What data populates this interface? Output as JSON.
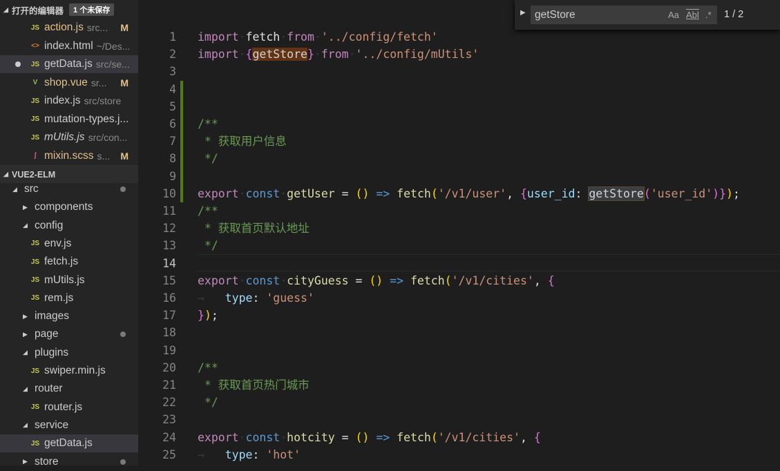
{
  "sidebar": {
    "open_editors": {
      "title": "打开的编辑器",
      "badge": "1 个未保存"
    },
    "open_files": [
      {
        "icon": "js-icon",
        "name": "action.js",
        "desc": "src...",
        "status": "M"
      },
      {
        "icon": "html-icon",
        "name": "index.html",
        "desc": "~/Des..."
      },
      {
        "icon": "js-icon",
        "name": "getData.js",
        "desc": "src/se...",
        "unsaved": true
      },
      {
        "icon": "vue-icon",
        "name": "shop.vue",
        "desc": "sr...",
        "status": "M"
      },
      {
        "icon": "js-icon",
        "name": "index.js",
        "desc": "src/store"
      },
      {
        "icon": "js-icon",
        "name": "mutation-types.j...",
        "desc": ""
      },
      {
        "icon": "js-icon",
        "name": "mUtils.js",
        "desc": "src/con..."
      },
      {
        "icon": "scss-icon",
        "name": "mixin.scss",
        "desc": "s...",
        "status": "M"
      }
    ],
    "project": {
      "title": "VUE2-ELM"
    },
    "tree": [
      {
        "name": "src",
        "type": "folder-open",
        "depth": 1,
        "dot": true
      },
      {
        "name": "components",
        "type": "folder",
        "depth": 2
      },
      {
        "name": "config",
        "type": "folder-open",
        "depth": 2
      },
      {
        "name": "env.js",
        "type": "js",
        "depth": 3
      },
      {
        "name": "fetch.js",
        "type": "js",
        "depth": 3
      },
      {
        "name": "mUtils.js",
        "type": "js",
        "depth": 3
      },
      {
        "name": "rem.js",
        "type": "js",
        "depth": 3
      },
      {
        "name": "images",
        "type": "folder",
        "depth": 2
      },
      {
        "name": "page",
        "type": "folder",
        "depth": 2,
        "dot": true
      },
      {
        "name": "plugins",
        "type": "folder-open",
        "depth": 2
      },
      {
        "name": "swiper.min.js",
        "type": "js",
        "depth": 3
      },
      {
        "name": "router",
        "type": "folder-open",
        "depth": 2
      },
      {
        "name": "router.js",
        "type": "js",
        "depth": 3
      },
      {
        "name": "service",
        "type": "folder-open",
        "depth": 2
      },
      {
        "name": "getData.js",
        "type": "js",
        "depth": 3,
        "selected": true
      },
      {
        "name": "store",
        "type": "folder",
        "depth": 2,
        "dot": true
      }
    ]
  },
  "find": {
    "query": "getStore",
    "match_case": "Aa",
    "whole_word": "Abl",
    "regex": ".*",
    "count": "1 / 2"
  },
  "editor": {
    "current_line": 14,
    "lines": [
      [
        [
          "kw",
          "import"
        ],
        [
          "ws",
          "·"
        ],
        [
          "id",
          "fetch"
        ],
        [
          "ws",
          "·"
        ],
        [
          "kw",
          "from"
        ],
        [
          "ws",
          "·"
        ],
        [
          "s",
          "'../config/fetch'"
        ]
      ],
      [
        [
          "kw",
          "import"
        ],
        [
          "ws",
          "·"
        ],
        [
          "b",
          "{"
        ],
        [
          "hl",
          "getStore"
        ],
        [
          "b",
          "}"
        ],
        [
          "ws",
          "·"
        ],
        [
          "kw",
          "from"
        ],
        [
          "ws",
          "·"
        ],
        [
          "s",
          "'../config/mUtils'"
        ]
      ],
      [],
      [],
      [],
      [
        [
          "c",
          "/**"
        ]
      ],
      [
        [
          "c",
          " * 获取用户信息"
        ]
      ],
      [
        [
          "c",
          " */"
        ]
      ],
      [],
      [
        [
          "kw",
          "export"
        ],
        [
          "ws",
          "·"
        ],
        [
          "st",
          "const"
        ],
        [
          "ws",
          "·"
        ],
        [
          "fn",
          "getUser"
        ],
        [
          "id",
          " = "
        ],
        [
          "p",
          "()"
        ],
        [
          "st",
          " => "
        ],
        [
          "fn",
          "fetch"
        ],
        [
          "p",
          "("
        ],
        [
          "s",
          "'/v1/user'"
        ],
        [
          "id",
          ", "
        ],
        [
          "b",
          "{"
        ],
        [
          "pr",
          "user_id"
        ],
        [
          "id",
          ": "
        ],
        [
          "hl2",
          "getStore"
        ],
        [
          "b",
          "("
        ],
        [
          "s",
          "'user_id'"
        ],
        [
          "b",
          ")"
        ],
        [
          "b",
          "}"
        ],
        [
          "p",
          ")"
        ],
        [
          "id",
          ";"
        ]
      ],
      [
        [
          "c",
          "/**"
        ]
      ],
      [
        [
          "c",
          " * 获取首页默认地址"
        ]
      ],
      [
        [
          "c",
          " */"
        ]
      ],
      [],
      [
        [
          "kw",
          "export"
        ],
        [
          "ws",
          "·"
        ],
        [
          "st",
          "const"
        ],
        [
          "ws",
          "·"
        ],
        [
          "fn",
          "cityGuess"
        ],
        [
          "id",
          " = "
        ],
        [
          "p",
          "()"
        ],
        [
          "st",
          " => "
        ],
        [
          "fn",
          "fetch"
        ],
        [
          "p",
          "("
        ],
        [
          "s",
          "'/v1/cities'"
        ],
        [
          "id",
          ", "
        ],
        [
          "b",
          "{"
        ]
      ],
      [
        [
          "ws",
          "→   "
        ],
        [
          "pr",
          "type"
        ],
        [
          "id",
          ": "
        ],
        [
          "s",
          "'guess'"
        ]
      ],
      [
        [
          "b",
          "}"
        ],
        [
          "p",
          ")"
        ],
        [
          "id",
          ";"
        ]
      ],
      [],
      [],
      [
        [
          "c",
          "/**"
        ]
      ],
      [
        [
          "c",
          " * 获取首页热门城市"
        ]
      ],
      [
        [
          "c",
          " */"
        ]
      ],
      [],
      [
        [
          "kw",
          "export"
        ],
        [
          "ws",
          "·"
        ],
        [
          "st",
          "const"
        ],
        [
          "ws",
          "·"
        ],
        [
          "fn",
          "hotcity"
        ],
        [
          "id",
          " = "
        ],
        [
          "p",
          "()"
        ],
        [
          "st",
          " => "
        ],
        [
          "fn",
          "fetch"
        ],
        [
          "p",
          "("
        ],
        [
          "s",
          "'/v1/cities'"
        ],
        [
          "id",
          ", "
        ],
        [
          "b",
          "{"
        ]
      ],
      [
        [
          "ws",
          "→   "
        ],
        [
          "pr",
          "type"
        ],
        [
          "id",
          ": "
        ],
        [
          "s",
          "'hot'"
        ]
      ]
    ]
  }
}
